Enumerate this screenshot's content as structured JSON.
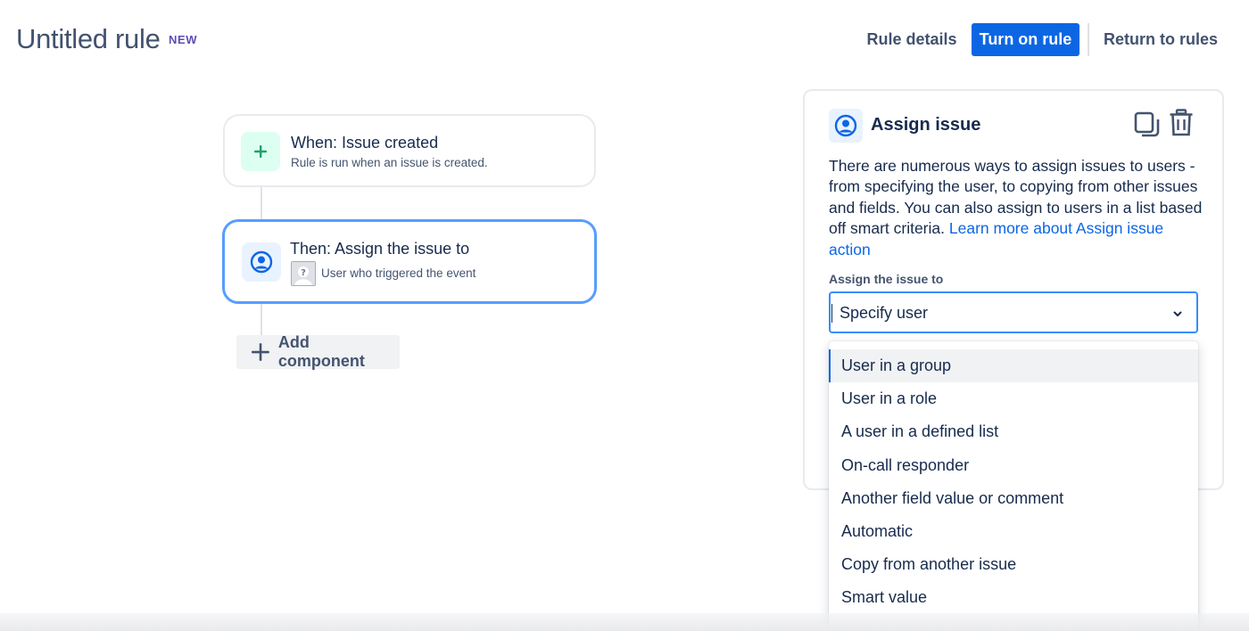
{
  "header": {
    "title": "Untitled rule",
    "badge": "NEW",
    "rule_details": "Rule details",
    "turn_on": "Turn on rule",
    "return": "Return to rules"
  },
  "flow": {
    "trigger": {
      "title": "When: Issue created",
      "subtitle": "Rule is run when an issue is created.",
      "icon": "plus-icon"
    },
    "action": {
      "title": "Then: Assign the issue to",
      "subtitle": "User who triggered the event",
      "icon": "user-circle-icon"
    },
    "add_component": "Add component"
  },
  "panel": {
    "title": "Assign issue",
    "description": "There are numerous ways to assign issues to users - from specifying the user, to copying from other issues and fields. You can also assign to users in a list based off smart criteria.",
    "learn_more": "Learn more about Assign issue action",
    "field_label": "Assign the issue to",
    "selected": "Specify user",
    "options": [
      "User in a group",
      "User in a role",
      "A user in a defined list",
      "On-call responder",
      "Another field value or comment",
      "Automatic",
      "Copy from another issue",
      "Smart value"
    ],
    "highlighted_option": "User in a group"
  },
  "colors": {
    "primary": "#0c66e4",
    "selected_border": "#579dff",
    "badge": "#5e4db2",
    "trigger_icon_bg": "#dcfff1",
    "action_icon_bg": "#e9f2ff"
  }
}
